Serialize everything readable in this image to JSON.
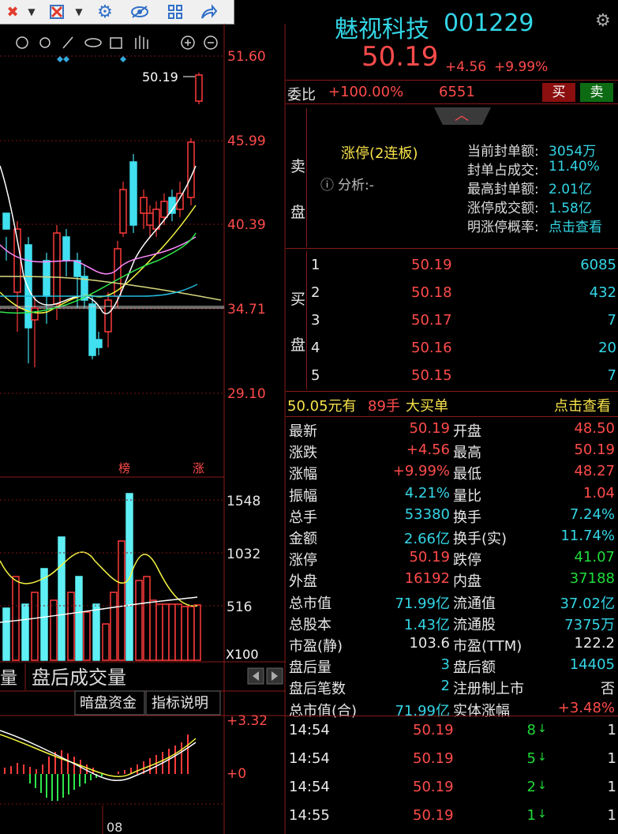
{
  "toolbar": {
    "icons": [
      "close-x-icon",
      "dropdown-arrow-icon",
      "gear-icon",
      "eye-hide-icon",
      "grid-icon",
      "share-arrow-icon"
    ]
  },
  "chart": {
    "last_price_marker": "50.19",
    "price_axis": [
      "51.60",
      "45.99",
      "40.39",
      "34.71",
      "29.10"
    ],
    "markers": {
      "bang": "榜",
      "zhang": "涨"
    },
    "volume_axis": [
      "1548",
      "1032",
      "516"
    ],
    "volume_unit": "X100",
    "tab_label_partial": "量",
    "tab_label": "盘后成交量",
    "dark_pool_button": "暗盘资金",
    "indicator_button": "指标说明",
    "macd_axis": [
      "+3.32",
      "+0"
    ],
    "date_label": "08"
  },
  "header": {
    "name": "魅视科技",
    "code": "001229",
    "price": "50.19",
    "change": "+4.56",
    "change_pct": "+9.99%"
  },
  "weibi": {
    "label": "委比",
    "ratio": "+100.00%",
    "diff": "6551",
    "buy": "买",
    "sell": "卖"
  },
  "sell_side": {
    "label": "卖盘",
    "limit_status": "涨停(2连板)",
    "analysis_label": "分析:-",
    "stats": [
      {
        "k": "当前封单额:",
        "v": "3054万"
      },
      {
        "k": "封单占成交:",
        "v": "11.40%"
      },
      {
        "k": "最高封单额:",
        "v": "2.01亿"
      },
      {
        "k": "涨停成交额:",
        "v": "1.58亿"
      },
      {
        "k": "明涨停概率:",
        "v": "点击查看"
      }
    ]
  },
  "buy_side": {
    "label": "买盘",
    "rows": [
      {
        "n": "1",
        "price": "50.19",
        "vol": "6085"
      },
      {
        "n": "2",
        "price": "50.18",
        "vol": "432"
      },
      {
        "n": "3",
        "price": "50.17",
        "vol": "7"
      },
      {
        "n": "4",
        "price": "50.16",
        "vol": "20"
      },
      {
        "n": "5",
        "price": "50.15",
        "vol": "7"
      }
    ]
  },
  "big_order": {
    "price": "50.05元有",
    "qty": "89手",
    "text": "大买单",
    "link": "点击查看"
  },
  "quote_left": [
    {
      "k": "最新",
      "v": "50.19",
      "c": "red"
    },
    {
      "k": "涨跌",
      "v": "+4.56",
      "c": "red"
    },
    {
      "k": "涨幅",
      "v": "+9.99%",
      "c": "red"
    },
    {
      "k": "振幅",
      "v": "4.21%",
      "c": "cyan"
    },
    {
      "k": "总手",
      "v": "53380",
      "c": "cyan"
    },
    {
      "k": "金额",
      "v": "2.66亿",
      "c": "cyan"
    },
    {
      "k": "涨停",
      "v": "50.19",
      "c": "red"
    },
    {
      "k": "外盘",
      "v": "16192",
      "c": "red"
    },
    {
      "k": "总市值",
      "v": "71.99亿",
      "c": "cyan"
    },
    {
      "k": "总股本",
      "v": "1.43亿",
      "c": "cyan"
    },
    {
      "k": "市盈(静)",
      "v": "103.6",
      "c": "white"
    },
    {
      "k": "盘后量",
      "v": "3",
      "c": "cyan"
    },
    {
      "k": "盘后笔数",
      "v": "2",
      "c": "cyan"
    },
    {
      "k": "总市值(合)",
      "v": "71.99亿",
      "c": "cyan"
    }
  ],
  "quote_right": [
    {
      "k": "开盘",
      "v": "48.50",
      "c": "red"
    },
    {
      "k": "最高",
      "v": "50.19",
      "c": "red"
    },
    {
      "k": "最低",
      "v": "48.27",
      "c": "red"
    },
    {
      "k": "量比",
      "v": "1.04",
      "c": "red"
    },
    {
      "k": "换手",
      "v": "7.24%",
      "c": "cyan"
    },
    {
      "k": "换手(实)",
      "v": "11.74%",
      "c": "cyan"
    },
    {
      "k": "跌停",
      "v": "41.07",
      "c": "green"
    },
    {
      "k": "内盘",
      "v": "37188",
      "c": "green"
    },
    {
      "k": "流通值",
      "v": "37.02亿",
      "c": "cyan"
    },
    {
      "k": "流通股",
      "v": "7375万",
      "c": "cyan"
    },
    {
      "k": "市盈(TTM)",
      "v": "122.2",
      "c": "white"
    },
    {
      "k": "盘后额",
      "v": "14405",
      "c": "cyan"
    },
    {
      "k": "注册制上市",
      "v": "否",
      "c": "white"
    },
    {
      "k": "实体涨幅",
      "v": "+3.48%",
      "c": "red"
    }
  ],
  "ticks": [
    {
      "time": "14:54",
      "price": "50.19",
      "vol": "8",
      "n": "1"
    },
    {
      "time": "14:54",
      "price": "50.19",
      "vol": "5",
      "n": "1"
    },
    {
      "time": "14:54",
      "price": "50.19",
      "vol": "2",
      "n": "1"
    },
    {
      "time": "14:55",
      "price": "50.19",
      "vol": "1",
      "n": "1"
    }
  ]
}
